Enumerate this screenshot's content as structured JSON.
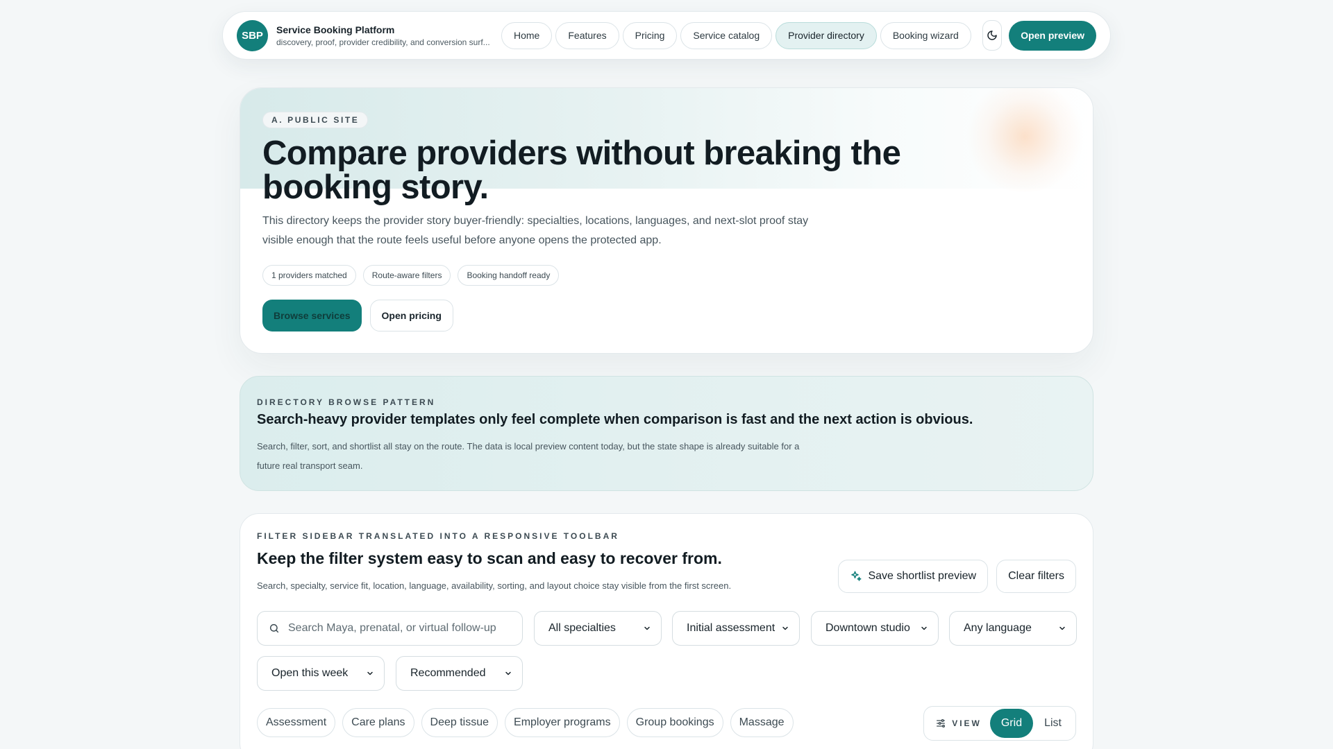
{
  "brand": {
    "logo_text": "SBP",
    "title": "Service Booking Platform",
    "subtitle": "discovery, proof, provider credibility, and conversion surf..."
  },
  "nav": {
    "items": [
      {
        "label": "Home",
        "active": false
      },
      {
        "label": "Features",
        "active": false
      },
      {
        "label": "Pricing",
        "active": false
      },
      {
        "label": "Service catalog",
        "active": false
      },
      {
        "label": "Provider directory",
        "active": true
      },
      {
        "label": "Booking wizard",
        "active": false
      }
    ],
    "theme_icon": "moon-icon",
    "cta_label": "Open preview"
  },
  "hero": {
    "eyebrow": "A. PUBLIC SITE",
    "title": "Compare providers without breaking the booking story.",
    "description": "This directory keeps the provider story buyer-friendly: specialties, locations, languages, and next-slot proof stay visible enough that the route feels useful before anyone opens the protected app.",
    "chips": [
      "1 providers matched",
      "Route-aware filters",
      "Booking handoff ready"
    ],
    "primary_cta": "Browse services",
    "secondary_cta": "Open pricing"
  },
  "pattern": {
    "eyebrow": "DIRECTORY BROWSE PATTERN",
    "title": "Search-heavy provider templates only feel complete when comparison is fast and the next action is obvious.",
    "description": "Search, filter, sort, and shortlist all stay on the route. The data is local preview content today, but the state shape is already suitable for a future real transport seam."
  },
  "filters": {
    "eyebrow": "FILTER SIDEBAR TRANSLATED INTO A RESPONSIVE TOOLBAR",
    "title": "Keep the filter system easy to scan and easy to recover from.",
    "description": "Search, specialty, service fit, location, language, availability, sorting, and layout choice stay visible from the first screen.",
    "save_label": "Save shortlist preview",
    "clear_label": "Clear filters",
    "search_placeholder": "Search Maya, prenatal, or virtual follow-up",
    "specialty": "All specialties",
    "service": "Initial assessment and care plan",
    "location": "Downtown studio",
    "language": "Any language",
    "availability": "Open this week",
    "sort": "Recommended",
    "tags": [
      "Assessment",
      "Care plans",
      "Deep tissue",
      "Employer programs",
      "Group bookings",
      "Massage"
    ],
    "view_label": "VIEW",
    "view_options": [
      "Grid",
      "List"
    ],
    "view_selected": "Grid"
  },
  "colors": {
    "accent": "#137f7b",
    "accent_soft": "#e3f1f1",
    "background": "#f4f7f8",
    "text": "#18232a"
  }
}
